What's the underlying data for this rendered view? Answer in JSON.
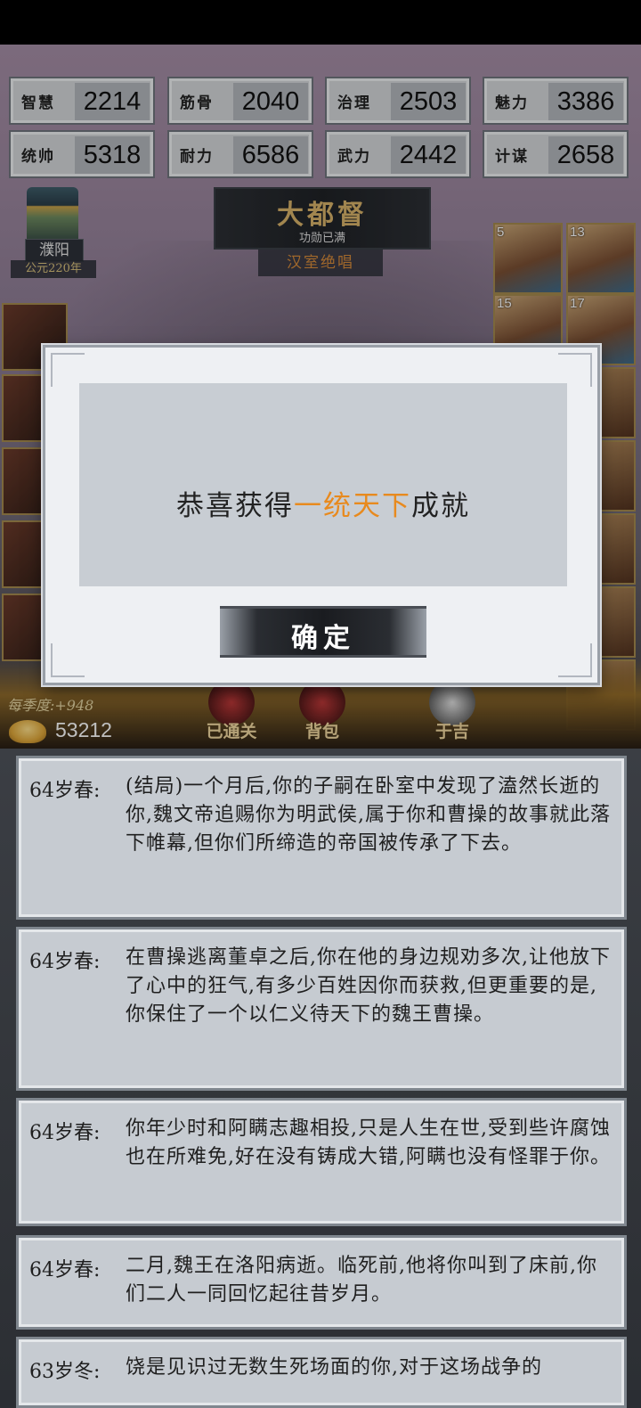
{
  "stats": [
    {
      "label": "智慧",
      "value": "2214"
    },
    {
      "label": "筋骨",
      "value": "2040"
    },
    {
      "label": "治理",
      "value": "2503"
    },
    {
      "label": "魅力",
      "value": "3386"
    },
    {
      "label": "统帅",
      "value": "5318"
    },
    {
      "label": "耐力",
      "value": "6586"
    },
    {
      "label": "武力",
      "value": "2442"
    },
    {
      "label": "计谋",
      "value": "2658"
    }
  ],
  "city": {
    "name": "濮阳",
    "year": "公元220年"
  },
  "rank": {
    "title": "大都督",
    "subtitle": "功勋已满",
    "ending": "汉室绝唱"
  },
  "portraits": {
    "numbers": [
      "5",
      "13",
      "15",
      "17"
    ]
  },
  "resources": {
    "season_income": "每季度:+948",
    "gold": "53212"
  },
  "menu": {
    "cleared": "已通关",
    "bag": "背包",
    "third": "于吉"
  },
  "modal": {
    "prefix": "恭喜获得",
    "highlight": "一统天下",
    "suffix": "成就",
    "confirm_label": "确定",
    "highlight_color": "#e88a1e"
  },
  "log": [
    {
      "age": "64岁春:",
      "text": "(结局)一个月后,你的子嗣在卧室中发现了溘然长逝的你,魏文帝追赐你为明武侯,属于你和曹操的故事就此落下帷幕,但你们所缔造的帝国被传承了下去。"
    },
    {
      "age": "64岁春:",
      "text": "在曹操逃离董卓之后,你在他的身边规劝多次,让他放下了心中的狂气,有多少百姓因你而获救,但更重要的是,你保住了一个以仁义待天下的魏王曹操。"
    },
    {
      "age": "64岁春:",
      "text": "你年少时和阿瞒志趣相投,只是人生在世,受到些许腐蚀也在所难免,好在没有铸成大错,阿瞒也没有怪罪于你。"
    },
    {
      "age": "64岁春:",
      "text": "二月,魏王在洛阳病逝。临死前,他将你叫到了床前,你们二人一同回忆起往昔岁月。"
    },
    {
      "age": "63岁冬:",
      "text": "饶是见识过无数生死场面的你,对于这场战争的"
    }
  ]
}
